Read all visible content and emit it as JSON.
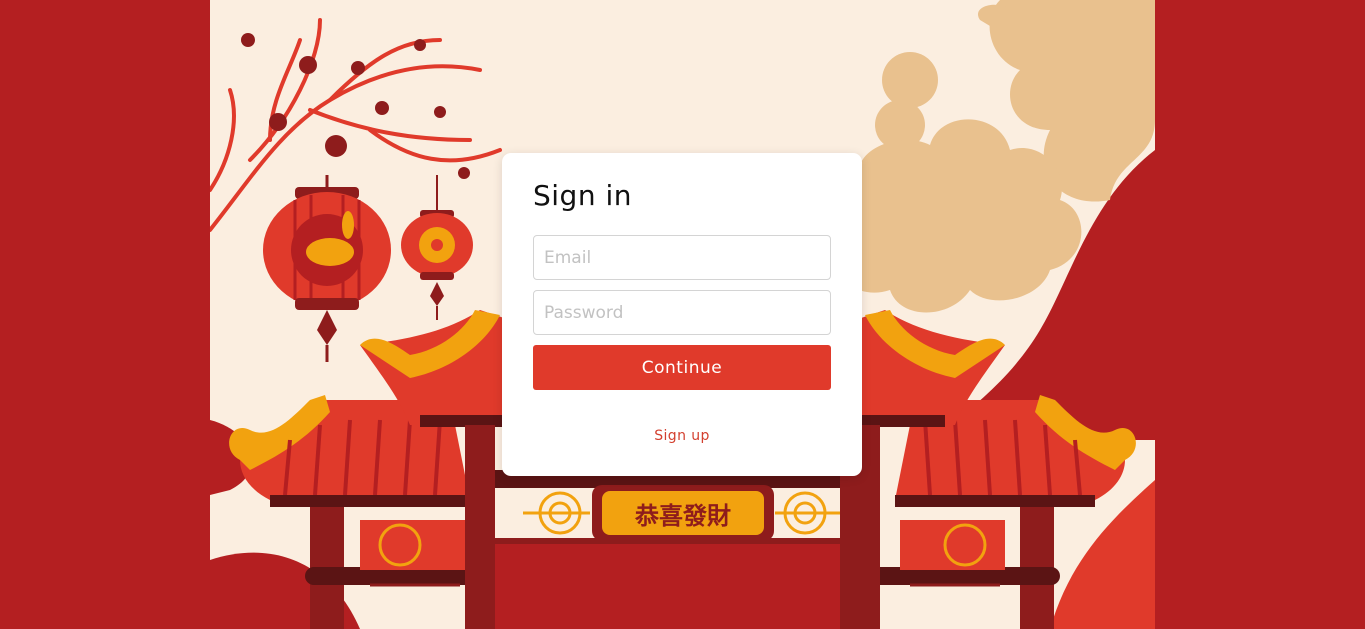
{
  "colors": {
    "page_background": "#b41f21",
    "sky": "#fbeee0",
    "cloud": "#e9c18e",
    "accent": "#e03a2b",
    "gold": "#f2a20f"
  },
  "login": {
    "title": "Sign in",
    "email_placeholder": "Email",
    "email_value": "",
    "password_placeholder": "Password",
    "password_value": "",
    "continue_label": "Continue",
    "signup_label": "Sign up"
  },
  "illustration": {
    "gate_sign_text": "恭喜發財",
    "icons": [
      "cherry-blossom-branch-icon",
      "rabbit-lantern-icon",
      "flower-lantern-icon",
      "temple-gate-icon",
      "cloud-icon"
    ]
  }
}
